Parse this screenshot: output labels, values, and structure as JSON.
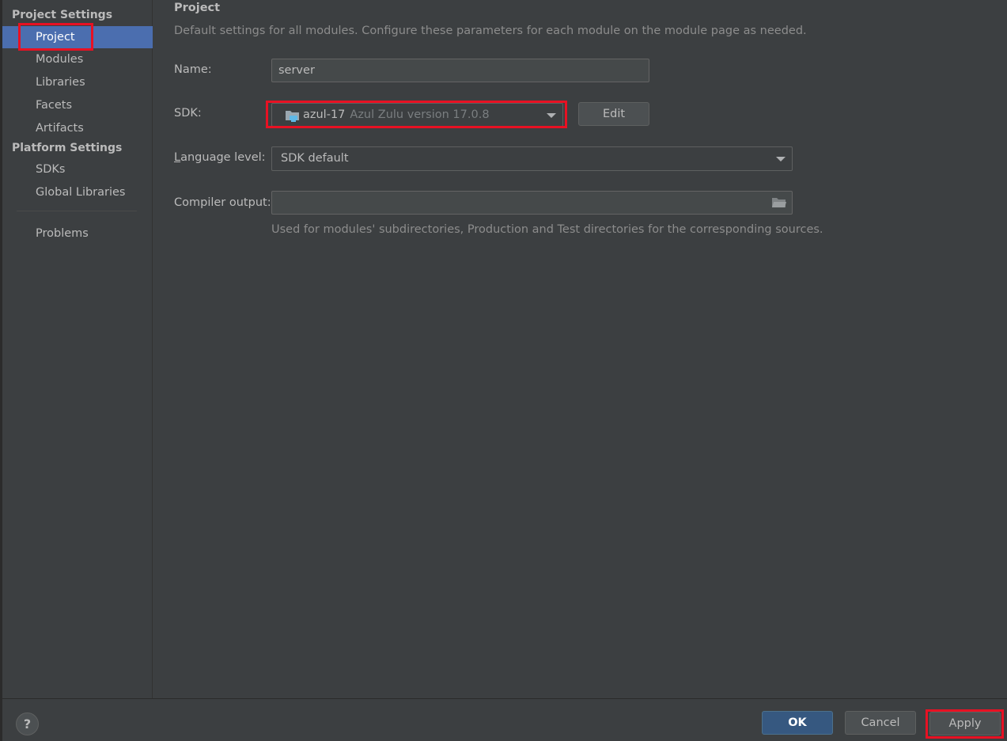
{
  "sidebar": {
    "project_settings_header": "Project Settings",
    "project_items": [
      {
        "label": "Project",
        "selected": true
      },
      {
        "label": "Modules"
      },
      {
        "label": "Libraries"
      },
      {
        "label": "Facets"
      },
      {
        "label": "Artifacts"
      }
    ],
    "platform_settings_header": "Platform Settings",
    "platform_items": [
      {
        "label": "SDKs"
      },
      {
        "label": "Global Libraries"
      }
    ],
    "problems_label": "Problems"
  },
  "main": {
    "title": "Project",
    "description": "Default settings for all modules. Configure these parameters for each module on the module page as needed.",
    "name_field": {
      "label": "Name:",
      "value": "server"
    },
    "sdk_field": {
      "label": "SDK:",
      "sdk_name": "azul-17",
      "sdk_version": "Azul Zulu version 17.0.8",
      "edit_label": "Edit"
    },
    "language_level": {
      "label_mnemonic": "L",
      "label_rest": "anguage level:",
      "value": "SDK default"
    },
    "compiler_output": {
      "label": "Compiler output:",
      "value": "",
      "hint": "Used for modules' subdirectories, Production and Test directories for the corresponding sources."
    }
  },
  "footer": {
    "help_label": "?",
    "ok_label": "OK",
    "cancel_label": "Cancel",
    "apply_label": "Apply"
  },
  "colors": {
    "background": "#3c3f41",
    "selection": "#4b6eaf",
    "primary_button": "#365880",
    "highlight": "#e81123",
    "sdk_icon": "#5fb8e6"
  }
}
